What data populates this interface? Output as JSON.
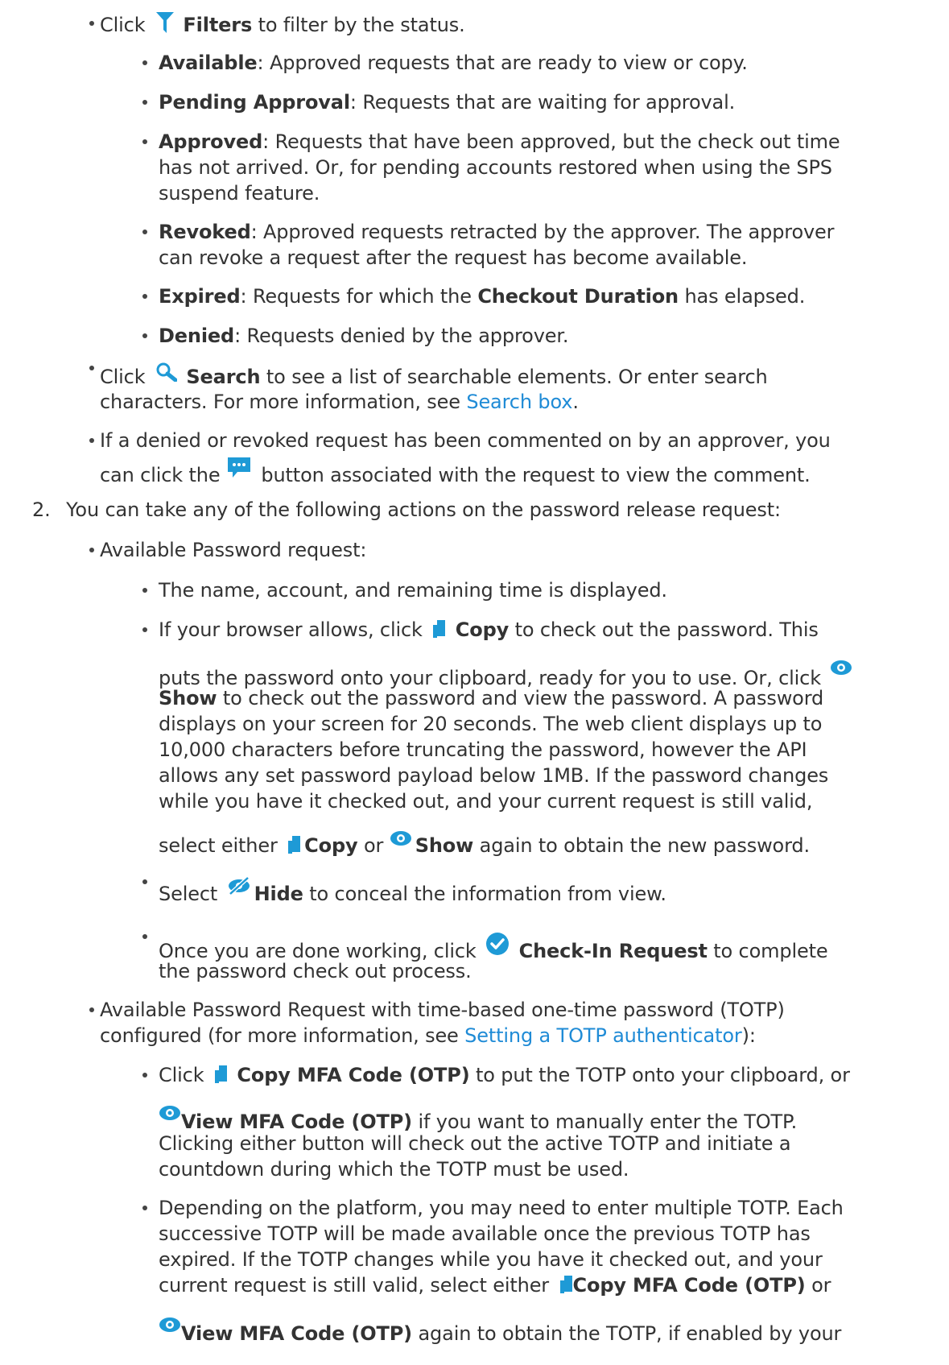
{
  "filters": {
    "click": "Click",
    "label": "Filters",
    "rest": "to filter by the status.",
    "icon": "funnel-icon",
    "items": [
      {
        "term": "Available",
        "l1": ": Approved requests that are ready to view or copy."
      },
      {
        "term": "Pending Approval",
        "l1": ": Requests that are waiting for approval."
      },
      {
        "term": "Approved",
        "l1": ": Requests that have been approved, but the check out time",
        "l2": "has not arrived. Or, for pending accounts restored when using the SPS",
        "l3": "suspend feature."
      },
      {
        "term": "Revoked",
        "l1": ": Approved requests retracted by the approver. The approver",
        "l2": "can revoke a request after the request has become available."
      },
      {
        "term": "Expired",
        "l1": ": Requests for which the ",
        "bold": "Checkout Duration",
        "l1b": " has elapsed."
      },
      {
        "term": "Denied",
        "l1": ": Requests denied by the approver."
      }
    ]
  },
  "search": {
    "click": "Click",
    "label": "Search",
    "rest": "to see a list of searchable elements. Or enter search",
    "l2a": "characters. For more information, see ",
    "link": "Search box",
    "l2b": ".",
    "icon": "magnifier-icon"
  },
  "comment": {
    "l1": "If a denied or revoked request has been commented on by an approver, you",
    "l2a": "can click the",
    "l2b": "button associated with the request to view the comment.",
    "icon": "speech-bubble-icon"
  },
  "step2": {
    "number": "2.",
    "text": "You can take any of the following actions on the password release request:"
  },
  "available": {
    "heading": "Available Password request:",
    "name_line": "The name, account, and remaining time is displayed.",
    "copy": {
      "a": "If your browser allows, click",
      "copy": "Copy",
      "b": "to check out the password. This",
      "l2": "puts the password onto your clipboard, ready for you to use. Or, click",
      "show": "Show",
      "l3": "to check out the password and view the password. A password",
      "l4": "displays on your screen for 20 seconds. The web client displays up to",
      "l5": "10,000 characters before truncating the password, however the API",
      "l6": "allows any set password payload below 1MB. If the password changes",
      "l7": "while you have it checked out, and your current request is still valid,",
      "l8a": "select either",
      "l8copy": "Copy",
      "l8or": "or",
      "l8show": "Show",
      "l8b": "again to obtain the new password."
    },
    "hide": {
      "a": "Select",
      "label": "Hide",
      "b": "to conceal the information from view."
    },
    "checkin": {
      "a": "Once you are done working, click",
      "label": "Check-In Request",
      "b": "to complete",
      "l2": "the password check out process."
    }
  },
  "totp": {
    "l1": "Available Password Request with time-based one-time password (TOTP)",
    "l2a": "configured (for more information, see ",
    "link": "Setting a TOTP authenticator",
    "l2b": "):",
    "copy": {
      "a": "Click",
      "label": "Copy MFA Code (OTP)",
      "b": "to put the TOTP onto your clipboard, or",
      "view": "View MFA Code (OTP)",
      "l2": "if you want to manually enter the TOTP.",
      "l3": "Clicking either button will check out the active TOTP and initiate a",
      "l4": "countdown during which the TOTP must be used."
    },
    "multi": {
      "l1": "Depending on the platform, you may need to enter multiple TOTP. Each",
      "l2": "successive TOTP will be made available once the previous TOTP has",
      "l3": "expired. If the TOTP changes while you have it checked out, and your",
      "l4a": "current request is still valid, select either",
      "l4copy": "Copy MFA Code (OTP)",
      "l4b": "or",
      "l5view": "View MFA Code (OTP)",
      "l5b": "again to obtain the TOTP, if enabled by your"
    }
  },
  "colors": {
    "text": "#333333",
    "link": "#1f8bd6",
    "icon": "#1e9ad6"
  }
}
